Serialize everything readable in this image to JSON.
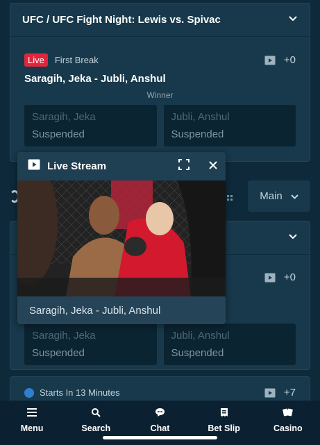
{
  "event_card": {
    "title": "UFC / UFC Fight Night: Lewis vs. Spivac",
    "live_badge": "Live",
    "period": "First Break",
    "more_markets": "+0",
    "match": "Saragih, Jeka - Jubli, Anshul",
    "market": "Winner",
    "odds": [
      {
        "name": "Saragih, Jeka",
        "status": "Suspended"
      },
      {
        "name": "Jubli, Anshul",
        "status": "Suspended"
      }
    ]
  },
  "filter": {
    "main_label": "Main"
  },
  "second_card": {
    "more_markets": "+0",
    "odds": [
      {
        "name": "Saragih, Jeka",
        "status": "Suspended"
      },
      {
        "name": "Jubli, Anshul",
        "status": "Suspended"
      }
    ]
  },
  "third_row": {
    "starts_in": "Starts In 13 Minutes",
    "more_markets": "+7"
  },
  "live_stream": {
    "title": "Live Stream",
    "caption": "Saragih, Jeka - Jubli, Anshul"
  },
  "bottom_nav": [
    {
      "label": "Menu",
      "icon": "menu-icon"
    },
    {
      "label": "Search",
      "icon": "search-icon"
    },
    {
      "label": "Chat",
      "icon": "chat-icon"
    },
    {
      "label": "Bet Slip",
      "icon": "betslip-icon"
    },
    {
      "label": "Casino",
      "icon": "casino-icon"
    }
  ],
  "colors": {
    "background": "#0e2a3a",
    "card": "#17394b",
    "live": "#e0263d"
  }
}
